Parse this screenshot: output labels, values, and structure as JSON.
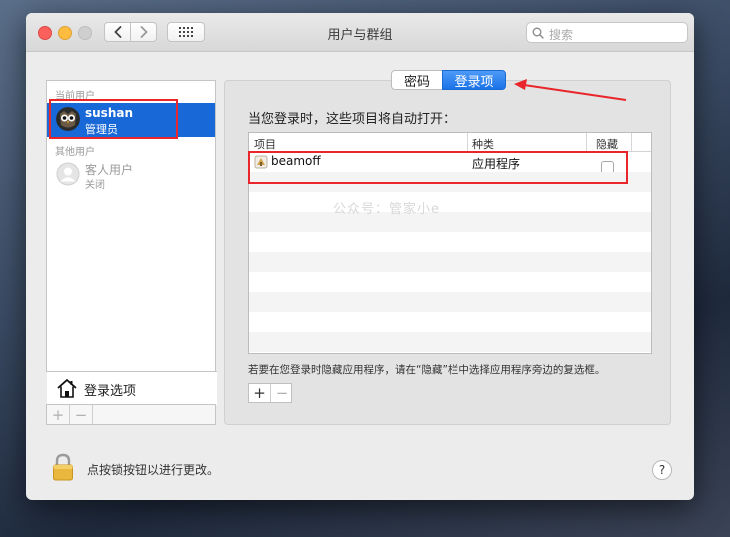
{
  "window": {
    "title": "用户与群组",
    "search_placeholder": "搜索"
  },
  "sidebar": {
    "current_users_label": "当前用户",
    "current_user": {
      "name": "sushan",
      "role": "管理员"
    },
    "other_users_label": "其他用户",
    "guest_user": {
      "name": "客人用户",
      "status": "关闭"
    },
    "login_options_label": "登录选项"
  },
  "tabs": [
    {
      "label": "密码",
      "selected": false
    },
    {
      "label": "登录项",
      "selected": true
    }
  ],
  "main": {
    "heading": "当您登录时，这些项目将自动打开：",
    "columns": [
      "项目",
      "种类",
      "隐藏"
    ],
    "rows": [
      {
        "item": "beamoff",
        "kind": "应用程序",
        "hidden": false
      }
    ],
    "hint": "若要在您登录时隐藏应用程序，请在“隐藏”栏中选择应用程序旁边的复选框。",
    "watermark": "公众号：管家小e"
  },
  "footer": {
    "lock_text": "点按锁按钮以进行更改。",
    "help_label": "?"
  },
  "buttons": {
    "add": "+",
    "remove": "−"
  },
  "colors": {
    "selection_blue": "#1868d8",
    "accent_blue": "#1a72e8",
    "annotation_red": "#e8262b"
  }
}
